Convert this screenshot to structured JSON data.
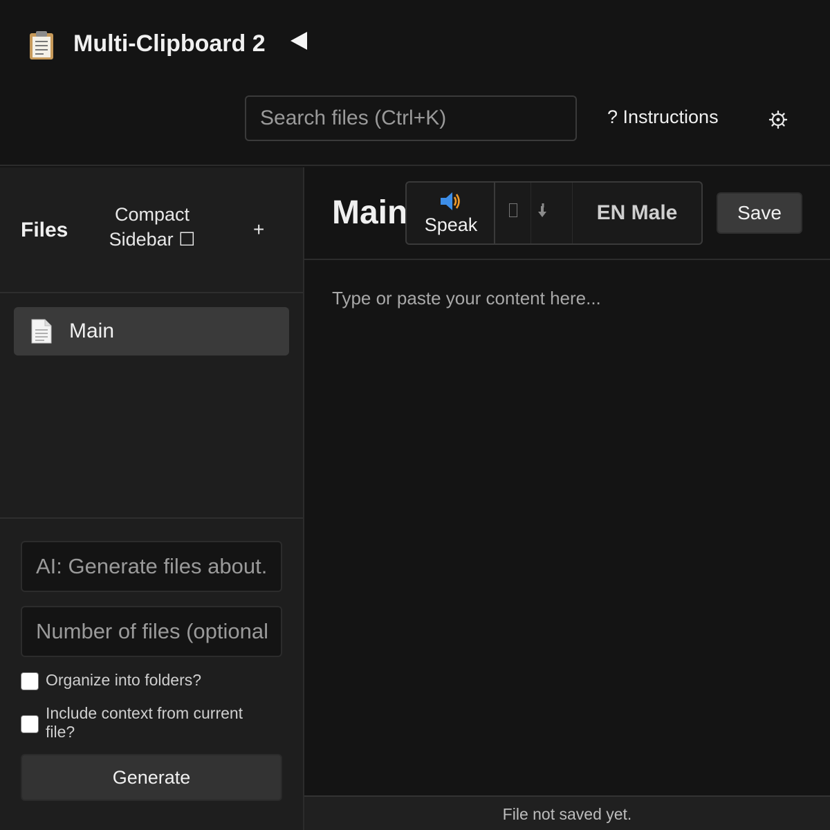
{
  "header": {
    "app_icon": "clipboard-icon",
    "title": "Multi-Clipboard 2",
    "collapse_icon": "triangle-left-icon",
    "search_placeholder": "Search files (Ctrl+K)",
    "instructions_label": "? Instructions",
    "settings_icon": "gear-icon"
  },
  "sidebar": {
    "title": "Files",
    "compact_label": "Compact Sidebar ☐",
    "add_label": "+",
    "files": [
      {
        "name": "Main",
        "icon": "document-icon",
        "active": true
      }
    ],
    "ai": {
      "topic_placeholder": "AI: Generate files about...",
      "count_placeholder": "Number of files (optional)",
      "organize_label": "Organize into folders?",
      "organize_checked": false,
      "context_label": "Include context from current file?",
      "context_checked": false,
      "generate_label": "Generate"
    }
  },
  "editor": {
    "title": "Main",
    "speak_icon": "speaker-icon",
    "speak_label": "Speak",
    "unknown_icon": "missing-glyph-icon",
    "download_icon": "download-arrow-icon",
    "voice_label": "EN Male",
    "save_label": "Save",
    "content_value": "",
    "content_placeholder": "Type or paste your content here..."
  },
  "status": {
    "text": "File not saved yet."
  },
  "colors": {
    "background": "#141414",
    "sidebar": "#1e1e1e",
    "active_item": "#3a3a3a",
    "button": "#3a3a3a",
    "speaker_blue": "#3d8ee8",
    "speaker_orange": "#f09a2a"
  }
}
